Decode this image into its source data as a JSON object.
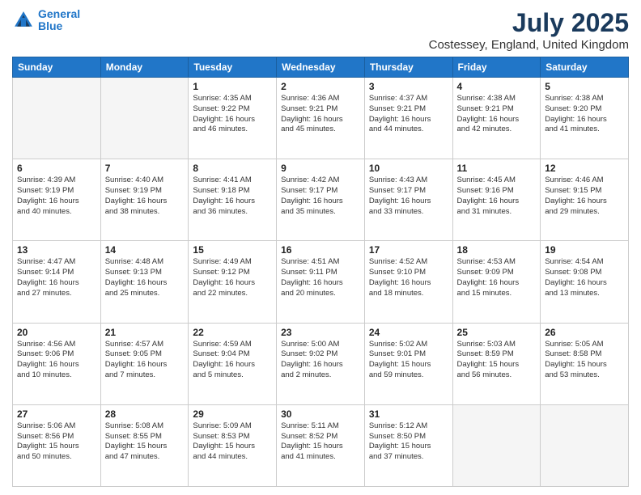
{
  "header": {
    "logo_line1": "General",
    "logo_line2": "Blue",
    "title": "July 2025",
    "subtitle": "Costessey, England, United Kingdom"
  },
  "days_of_week": [
    "Sunday",
    "Monday",
    "Tuesday",
    "Wednesday",
    "Thursday",
    "Friday",
    "Saturday"
  ],
  "weeks": [
    [
      {
        "day": "",
        "info": ""
      },
      {
        "day": "",
        "info": ""
      },
      {
        "day": "1",
        "info": "Sunrise: 4:35 AM\nSunset: 9:22 PM\nDaylight: 16 hours\nand 46 minutes."
      },
      {
        "day": "2",
        "info": "Sunrise: 4:36 AM\nSunset: 9:21 PM\nDaylight: 16 hours\nand 45 minutes."
      },
      {
        "day": "3",
        "info": "Sunrise: 4:37 AM\nSunset: 9:21 PM\nDaylight: 16 hours\nand 44 minutes."
      },
      {
        "day": "4",
        "info": "Sunrise: 4:38 AM\nSunset: 9:21 PM\nDaylight: 16 hours\nand 42 minutes."
      },
      {
        "day": "5",
        "info": "Sunrise: 4:38 AM\nSunset: 9:20 PM\nDaylight: 16 hours\nand 41 minutes."
      }
    ],
    [
      {
        "day": "6",
        "info": "Sunrise: 4:39 AM\nSunset: 9:19 PM\nDaylight: 16 hours\nand 40 minutes."
      },
      {
        "day": "7",
        "info": "Sunrise: 4:40 AM\nSunset: 9:19 PM\nDaylight: 16 hours\nand 38 minutes."
      },
      {
        "day": "8",
        "info": "Sunrise: 4:41 AM\nSunset: 9:18 PM\nDaylight: 16 hours\nand 36 minutes."
      },
      {
        "day": "9",
        "info": "Sunrise: 4:42 AM\nSunset: 9:17 PM\nDaylight: 16 hours\nand 35 minutes."
      },
      {
        "day": "10",
        "info": "Sunrise: 4:43 AM\nSunset: 9:17 PM\nDaylight: 16 hours\nand 33 minutes."
      },
      {
        "day": "11",
        "info": "Sunrise: 4:45 AM\nSunset: 9:16 PM\nDaylight: 16 hours\nand 31 minutes."
      },
      {
        "day": "12",
        "info": "Sunrise: 4:46 AM\nSunset: 9:15 PM\nDaylight: 16 hours\nand 29 minutes."
      }
    ],
    [
      {
        "day": "13",
        "info": "Sunrise: 4:47 AM\nSunset: 9:14 PM\nDaylight: 16 hours\nand 27 minutes."
      },
      {
        "day": "14",
        "info": "Sunrise: 4:48 AM\nSunset: 9:13 PM\nDaylight: 16 hours\nand 25 minutes."
      },
      {
        "day": "15",
        "info": "Sunrise: 4:49 AM\nSunset: 9:12 PM\nDaylight: 16 hours\nand 22 minutes."
      },
      {
        "day": "16",
        "info": "Sunrise: 4:51 AM\nSunset: 9:11 PM\nDaylight: 16 hours\nand 20 minutes."
      },
      {
        "day": "17",
        "info": "Sunrise: 4:52 AM\nSunset: 9:10 PM\nDaylight: 16 hours\nand 18 minutes."
      },
      {
        "day": "18",
        "info": "Sunrise: 4:53 AM\nSunset: 9:09 PM\nDaylight: 16 hours\nand 15 minutes."
      },
      {
        "day": "19",
        "info": "Sunrise: 4:54 AM\nSunset: 9:08 PM\nDaylight: 16 hours\nand 13 minutes."
      }
    ],
    [
      {
        "day": "20",
        "info": "Sunrise: 4:56 AM\nSunset: 9:06 PM\nDaylight: 16 hours\nand 10 minutes."
      },
      {
        "day": "21",
        "info": "Sunrise: 4:57 AM\nSunset: 9:05 PM\nDaylight: 16 hours\nand 7 minutes."
      },
      {
        "day": "22",
        "info": "Sunrise: 4:59 AM\nSunset: 9:04 PM\nDaylight: 16 hours\nand 5 minutes."
      },
      {
        "day": "23",
        "info": "Sunrise: 5:00 AM\nSunset: 9:02 PM\nDaylight: 16 hours\nand 2 minutes."
      },
      {
        "day": "24",
        "info": "Sunrise: 5:02 AM\nSunset: 9:01 PM\nDaylight: 15 hours\nand 59 minutes."
      },
      {
        "day": "25",
        "info": "Sunrise: 5:03 AM\nSunset: 8:59 PM\nDaylight: 15 hours\nand 56 minutes."
      },
      {
        "day": "26",
        "info": "Sunrise: 5:05 AM\nSunset: 8:58 PM\nDaylight: 15 hours\nand 53 minutes."
      }
    ],
    [
      {
        "day": "27",
        "info": "Sunrise: 5:06 AM\nSunset: 8:56 PM\nDaylight: 15 hours\nand 50 minutes."
      },
      {
        "day": "28",
        "info": "Sunrise: 5:08 AM\nSunset: 8:55 PM\nDaylight: 15 hours\nand 47 minutes."
      },
      {
        "day": "29",
        "info": "Sunrise: 5:09 AM\nSunset: 8:53 PM\nDaylight: 15 hours\nand 44 minutes."
      },
      {
        "day": "30",
        "info": "Sunrise: 5:11 AM\nSunset: 8:52 PM\nDaylight: 15 hours\nand 41 minutes."
      },
      {
        "day": "31",
        "info": "Sunrise: 5:12 AM\nSunset: 8:50 PM\nDaylight: 15 hours\nand 37 minutes."
      },
      {
        "day": "",
        "info": ""
      },
      {
        "day": "",
        "info": ""
      }
    ]
  ]
}
